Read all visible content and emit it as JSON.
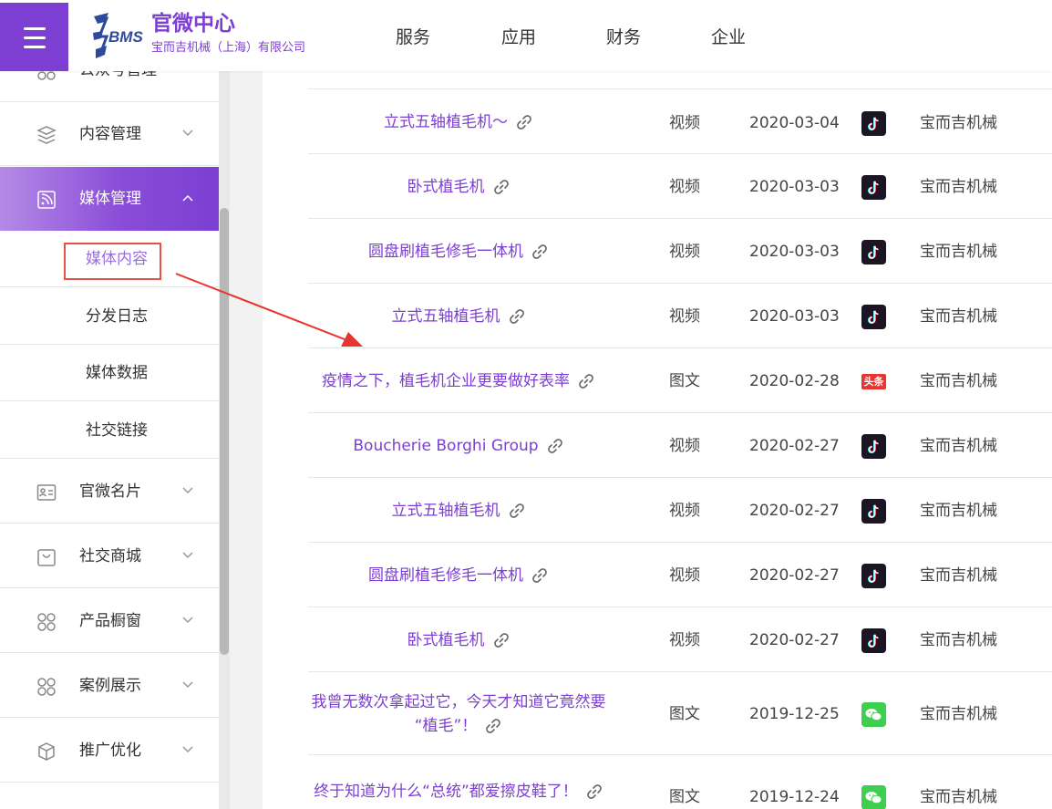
{
  "header": {
    "brand_title": "官微中心",
    "company": "宝而吉机械（上海）有限公司",
    "nav": [
      "服务",
      "应用",
      "财务",
      "企业"
    ],
    "accent_color": "#7c3fd2"
  },
  "sidebar": {
    "partial_item": "公众号管理",
    "items": [
      {
        "label": "内容管理",
        "icon": "layers-icon"
      },
      {
        "label": "媒体管理",
        "icon": "rss-icon"
      },
      {
        "label": "官微名片",
        "icon": "id-card-icon"
      },
      {
        "label": "社交商城",
        "icon": "shopping-bag-icon"
      },
      {
        "label": "产品橱窗",
        "icon": "grid-circles-icon"
      },
      {
        "label": "案例展示",
        "icon": "grid-circles-icon"
      },
      {
        "label": "推广优化",
        "icon": "cube-icon"
      }
    ],
    "sub_items": [
      "媒体内容",
      "分发日志",
      "媒体数据",
      "社交链接"
    ],
    "current_sub": "媒体内容"
  },
  "table": {
    "rows": [
      {
        "title": "立式五轴植毛机～",
        "type": "视频",
        "date": "2020-03-04",
        "platform": "douyin-icon",
        "owner": "宝而吉机械"
      },
      {
        "title": "卧式植毛机",
        "type": "视频",
        "date": "2020-03-03",
        "platform": "douyin-icon",
        "owner": "宝而吉机械"
      },
      {
        "title": "圆盘刷植毛修毛一体机",
        "type": "视频",
        "date": "2020-03-03",
        "platform": "douyin-icon",
        "owner": "宝而吉机械"
      },
      {
        "title": "立式五轴植毛机",
        "type": "视频",
        "date": "2020-03-03",
        "platform": "douyin-icon",
        "owner": "宝而吉机械"
      },
      {
        "title": "疫情之下，植毛机企业更要做好表率",
        "type": "图文",
        "date": "2020-02-28",
        "platform": "toutiao-icon",
        "platform_text": "头条",
        "owner": "宝而吉机械"
      },
      {
        "title": "Boucherie Borghi Group",
        "type": "视频",
        "date": "2020-02-27",
        "platform": "douyin-icon",
        "owner": "宝而吉机械"
      },
      {
        "title": "立式五轴植毛机",
        "type": "视频",
        "date": "2020-02-27",
        "platform": "douyin-icon",
        "owner": "宝而吉机械"
      },
      {
        "title": "圆盘刷植毛修毛一体机",
        "type": "视频",
        "date": "2020-02-27",
        "platform": "douyin-icon",
        "owner": "宝而吉机械"
      },
      {
        "title": "卧式植毛机",
        "type": "视频",
        "date": "2020-02-27",
        "platform": "douyin-icon",
        "owner": "宝而吉机械"
      },
      {
        "title_line1": "我曾无数次拿起过它，今天才知道它竟然要",
        "title_line2": "“植毛”！",
        "type": "图文",
        "date": "2019-12-25",
        "platform": "wechat-icon",
        "owner": "宝而吉机械"
      },
      {
        "title": "终于知道为什么“总统”都爱擦皮鞋了！",
        "type": "图文",
        "date": "2019-12-24",
        "platform": "wechat-icon",
        "owner": "宝而吉机械"
      }
    ],
    "platform_colors": {
      "douyin": "#1c1624",
      "toutiao": "#e8352f",
      "wechat": "#3fcf4f"
    }
  },
  "annotation": {
    "arrow_color": "#e8352f"
  }
}
